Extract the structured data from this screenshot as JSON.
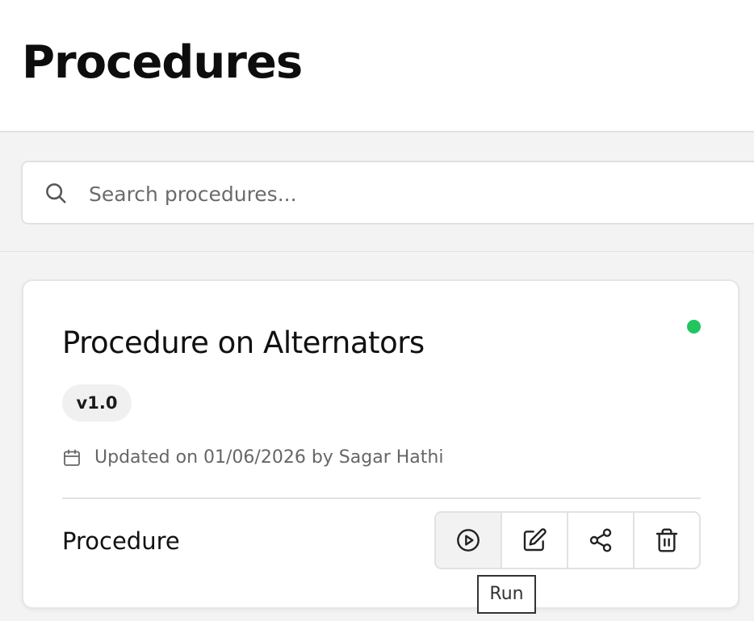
{
  "page": {
    "title": "Procedures"
  },
  "search": {
    "placeholder": "Search procedures...",
    "icon": "search-icon"
  },
  "procedures": [
    {
      "title": "Procedure on Alternators",
      "version": "v1.0",
      "status_color": "#22c55e",
      "updated_text": "Updated on 01/06/2026 by Sagar Hathi",
      "type": "Procedure",
      "actions": [
        {
          "name": "run",
          "icon": "play-circle-icon"
        },
        {
          "name": "edit",
          "icon": "edit-icon"
        },
        {
          "name": "share",
          "icon": "share-icon"
        },
        {
          "name": "delete",
          "icon": "trash-icon"
        }
      ]
    }
  ],
  "tooltip": {
    "text": "Run"
  },
  "colors": {
    "status_active": "#22c55e",
    "background": "#f3f3f3",
    "card_border": "#e6e6e6"
  }
}
